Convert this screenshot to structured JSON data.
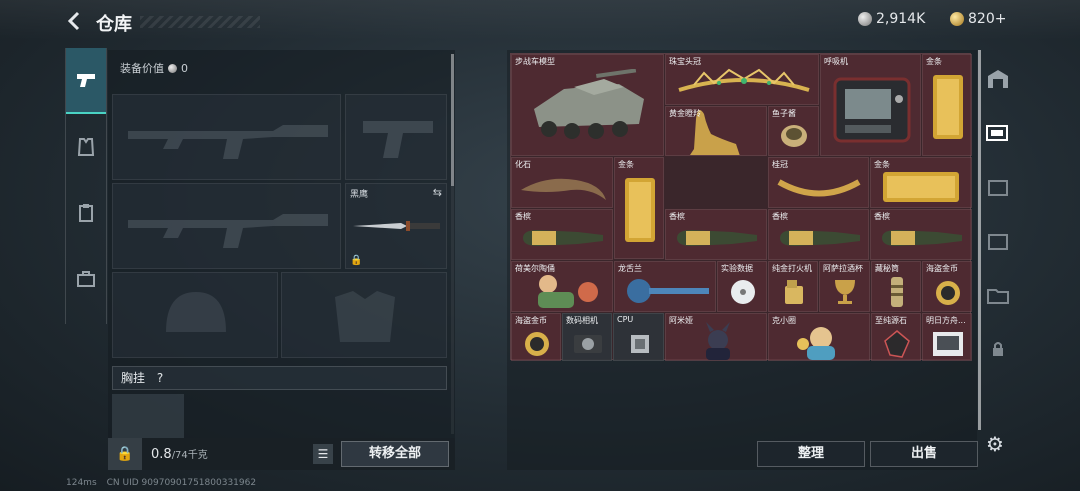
{
  "header": {
    "title": "仓库",
    "currency_silver": "2,914K",
    "currency_gold": "820+"
  },
  "loadout": {
    "equip_value_label": "装备价值",
    "equip_value": "0",
    "melee_label": "黑鹰",
    "chest_rig_label": "胸挂",
    "chest_rig_hint": "?",
    "weight_current": "0.8",
    "weight_max": "/74千克",
    "transfer_all": "转移全部"
  },
  "warehouse": {
    "items": [
      {
        "label": "步战车模型"
      },
      {
        "label": "珠宝头冠"
      },
      {
        "label": "呼吸机"
      },
      {
        "label": "金条"
      },
      {
        "label": "黄金瞪羚"
      },
      {
        "label": "鱼子酱"
      },
      {
        "label": "化石"
      },
      {
        "label": "金条"
      },
      {
        "label": "桂冠"
      },
      {
        "label": "金条"
      },
      {
        "label": "香槟"
      },
      {
        "label": "香槟"
      },
      {
        "label": "香槟"
      },
      {
        "label": "香槟"
      },
      {
        "label": "荷美尔陶俑"
      },
      {
        "label": "龙舌兰"
      },
      {
        "label": "实验数据"
      },
      {
        "label": "纯金打火机"
      },
      {
        "label": "阿萨拉酒杯"
      },
      {
        "label": "藏秘筒"
      },
      {
        "label": "海盗金币"
      },
      {
        "label": "海盗金币"
      },
      {
        "label": "数码相机"
      },
      {
        "label": "CPU"
      },
      {
        "label": "阿米娅"
      },
      {
        "label": "克小圈"
      },
      {
        "label": "至纯源石"
      },
      {
        "label": "明日方舟..."
      }
    ],
    "sort_button": "整理",
    "sell_button": "出售"
  },
  "footer": {
    "ping": "124ms",
    "uid": "CN UID 9097090175180033196​2"
  },
  "colors": {
    "accent": "#4ad3c4",
    "item_cell": "#5f2d37"
  }
}
